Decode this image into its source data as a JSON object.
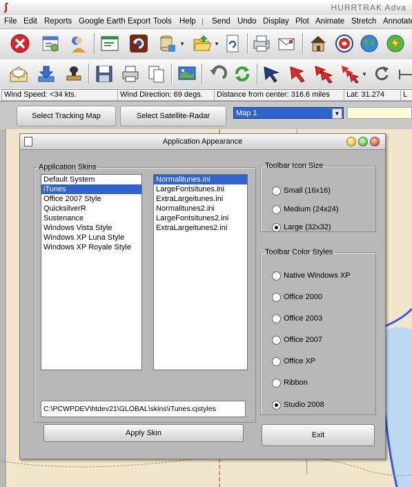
{
  "window": {
    "title": "HURRTRAK Adva"
  },
  "menu": [
    "File",
    "Edit",
    "Reports",
    "Google Earth Export",
    "Tools",
    "Help",
    "|",
    "Send",
    "Undo",
    "Display",
    "Plot",
    "Animate",
    "Stretch",
    "Annotate"
  ],
  "toolbar1": [
    "close-icon",
    "preferences-window-icon",
    "user-globe-icon",
    "window-icon",
    "refresh-icon",
    "database-icon",
    "open-folder-icon",
    "document-refresh-icon",
    "printer-setup-icon",
    "mail-icon",
    "house-icon",
    "storm-icon",
    "world-icon",
    "lightning-icon"
  ],
  "toolbar2": [
    "open-envelope-icon",
    "download-icon",
    "stamp-icon",
    "save-icon",
    "print-icon",
    "copy-icon",
    "satellite-map-icon",
    "undo-arc-icon",
    "refresh-arc-icon",
    "cursor-arrow-icon",
    "red-arrow-icon",
    "double-red-arrow-icon",
    "triple-red-arrow-icon",
    "rotate-icon",
    "dimension-icon"
  ],
  "status": {
    "wind_speed": "Wind Speed: <34 kts.",
    "wind_direction": "Wind Direction: 69 degs.",
    "distance": "Distance from center: 316.6 miles",
    "lat": "Lat: 31.274",
    "extra": "L"
  },
  "map_controls": {
    "tracking_button": "Select Tracking  Map",
    "satellite_button": "Select Satellite-Radar",
    "map_select_value": "Map 1"
  },
  "dialog": {
    "title": "Application Appearance",
    "skins_legend": "Application Skins",
    "skins": [
      "Default System",
      "iTunes",
      "Office 2007 Style",
      "QuicksilverR",
      "Sustenance",
      "Windows Vista Style",
      "Windows XP Luna Style",
      "Windows XP Royale Style"
    ],
    "skins_selected": "iTunes",
    "ini_files": [
      "Normalitunes.ini",
      "LargeFontsitunes.ini",
      "ExtraLargeitunes.ini",
      "Normalitunes2.ini",
      "LargeFontsitunes2.ini",
      "ExtraLargeitunes2.ini"
    ],
    "ini_selected": "Normalitunes.ini",
    "path": "C:\\PCWPDEV\\htdev21\\GLOBAL\\skins\\iTunes.cjstyles",
    "apply_button": "Apply Skin",
    "icon_size_legend": "Toolbar Icon Size",
    "icon_sizes": [
      "Small (16x16)",
      "Medium (24x24)",
      "Large (32x32)"
    ],
    "icon_size_selected": "Large (32x32)",
    "color_styles_legend": "Toolbar Color Styles",
    "color_styles": [
      "Native Windows XP",
      "Office 2000",
      "Office 2003",
      "Office 2007",
      "Office XP",
      "Ribbon",
      "Studio 2008"
    ],
    "color_style_selected": "Studio 2008",
    "exit_button": "Exit"
  },
  "colors": {
    "selection": "#3163ce",
    "map_land": "#f1e6cb",
    "coast_line": "#2f59e8",
    "track_line": "#c0392b"
  }
}
